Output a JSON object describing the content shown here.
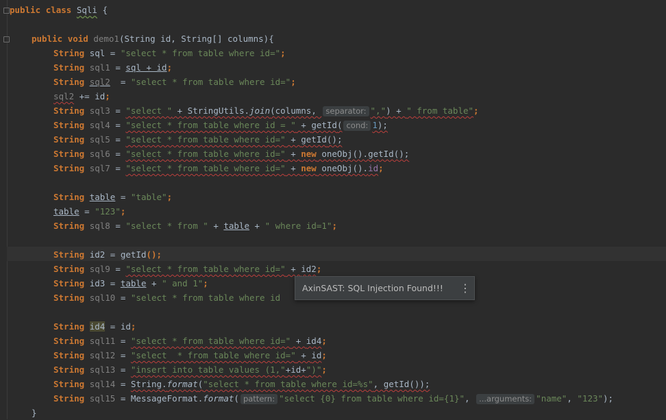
{
  "editor": {
    "popup": {
      "message": "AxinSAST: SQL Injection Found!!!",
      "menu_icon": "⋮"
    },
    "lines": {
      "l1": [
        "public",
        "class",
        "Sqli",
        "{"
      ],
      "l2": [
        "public",
        "void",
        "demo1",
        "(String id, String[] columns){"
      ],
      "l3": [
        "String",
        "sql",
        " = ",
        "\"select * from table where id=\"",
        ";"
      ],
      "l4": [
        "String",
        "sql1",
        " = ",
        "sql",
        " + ",
        "id",
        ";"
      ],
      "l5": [
        "String",
        "sql2",
        "  = ",
        "\"select * from table where id=\"",
        ";"
      ],
      "l6": [
        "sql2",
        " += ",
        "id",
        ";"
      ],
      "l7": [
        "String",
        "sql3",
        " = ",
        "\"select \"",
        " + StringUtils.",
        "join",
        "(columns, ",
        "separator:",
        "\",\"",
        ") + ",
        "\" from table\"",
        ";"
      ],
      "l8": [
        "String",
        "sql4",
        " = ",
        "\"select * from table where id = \"",
        " + ",
        "getId",
        "(",
        "cond:",
        "1",
        ");"
      ],
      "l9": [
        "String",
        "sql5",
        " = ",
        "\"select * from table where id=\"",
        " + ",
        "getId",
        "();"
      ],
      "l10": [
        "String",
        "sql6",
        " = ",
        "\"select * from table where id=\"",
        " + ",
        "new",
        " oneObj().getId();"
      ],
      "l11": [
        "String",
        "sql7",
        " = ",
        "\"select * from table where id=\"",
        " + ",
        "new",
        " oneObj().",
        "id",
        ";"
      ],
      "l12": [
        "String",
        "table",
        " = ",
        "\"table\"",
        ";"
      ],
      "l13": [
        "table",
        " = ",
        "\"123\"",
        ";"
      ],
      "l14": [
        "String",
        "sql8",
        " = ",
        "\"select * from \"",
        " + ",
        "table",
        " + ",
        "\" where id=1\"",
        ";"
      ],
      "l15": [
        "String",
        "id2",
        " = ",
        "getId",
        "();"
      ],
      "l16": [
        "String",
        "sql9",
        " = ",
        "\"select * from table where id=\"",
        " + ",
        "id2",
        ";"
      ],
      "l17": [
        "String",
        "id3",
        " = ",
        "table",
        " + ",
        "\" and 1\"",
        ";"
      ],
      "l18": [
        "String",
        "sql10",
        " = ",
        "\"select * from table where id"
      ],
      "l19": [
        "String",
        "id4",
        " = ",
        "id",
        ";"
      ],
      "l20": [
        "String",
        "sql11",
        " = ",
        "\"select * from table where id=\"",
        " + ",
        "id4",
        ";"
      ],
      "l21": [
        "String",
        "sql12",
        " = ",
        "\"select  * from table where id=\"",
        " + ",
        "id",
        ";"
      ],
      "l22": [
        "String",
        "sql13",
        " = ",
        "\"insert into table values (1,\"",
        "+id+",
        "\")\"",
        ";"
      ],
      "l23": [
        "String",
        "sql14",
        " = ",
        "String.",
        "format",
        "(",
        "\"select * from table where id=%s\"",
        ", getId());"
      ],
      "l24": [
        "String",
        "sql15",
        " = ",
        "MessageFormat.",
        "format",
        "(",
        "pattern:",
        "\"select {0} from table where id={1}\"",
        ", ",
        "...arguments:",
        "\"name\"",
        ", ",
        "\"123\"",
        ");"
      ],
      "l25": [
        "}"
      ]
    }
  }
}
